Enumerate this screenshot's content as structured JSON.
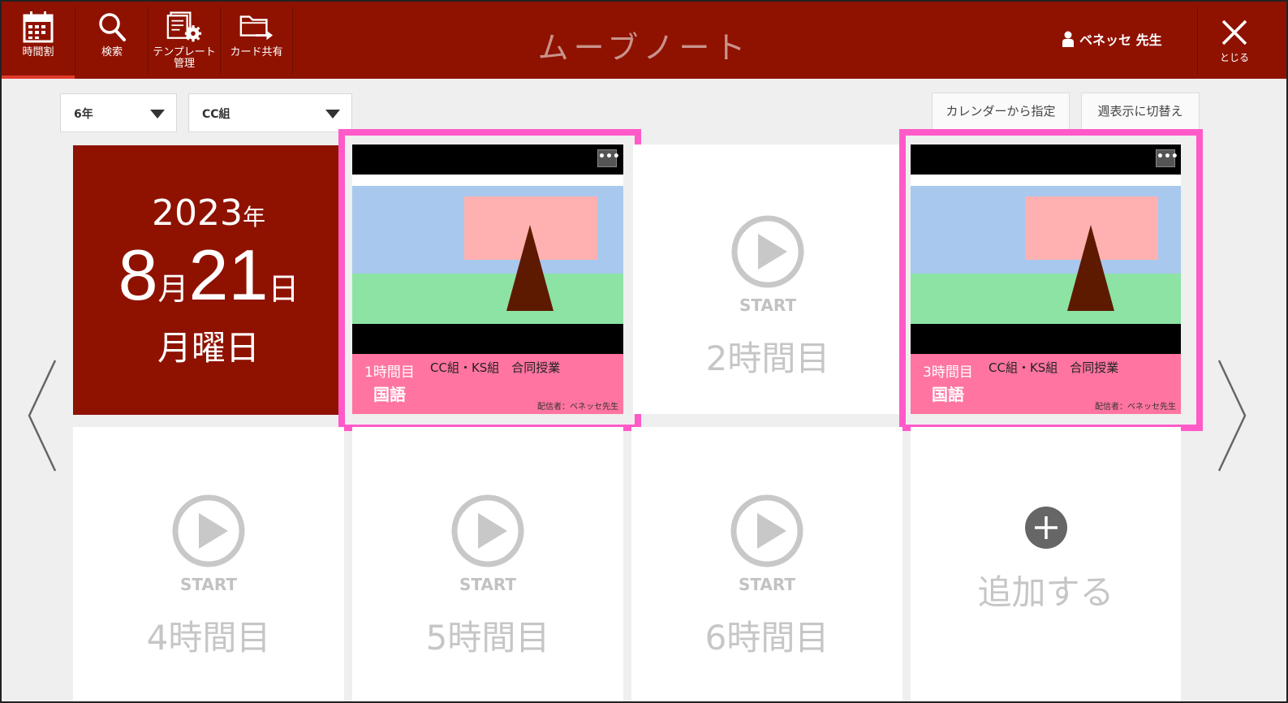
{
  "header": {
    "nav": [
      {
        "label": "時間割",
        "icon": "calendar-icon",
        "active": true
      },
      {
        "label": "検索",
        "icon": "search-icon"
      },
      {
        "label": "テンプレート\n管理",
        "label_line1": "テンプレート",
        "label_line2": "管理",
        "icon": "template-settings-icon"
      },
      {
        "label": "カード共有",
        "icon": "folder-share-icon"
      }
    ],
    "app_title": "ムーブノート",
    "user_name": "ベネッセ 先生",
    "close_label": "とじる"
  },
  "toolbar": {
    "grade": "6年",
    "class": "CC組",
    "calendar_button": "カレンダーから指定",
    "week_button": "週表示に切替え"
  },
  "date": {
    "year": "2023",
    "year_unit": "年",
    "month": "8",
    "month_unit": "月",
    "day": "21",
    "day_unit": "日",
    "weekday": "月曜日"
  },
  "lessons": [
    {
      "period": "1時間目",
      "classes": "CC組・KS組　合同授業",
      "subject": "国語",
      "distributor": "配信者：ベネッセ先生"
    },
    {
      "period": "3時間目",
      "classes": "CC組・KS組　合同授業",
      "subject": "国語",
      "distributor": "配信者：ベネッセ先生"
    }
  ],
  "empty_slots": [
    {
      "start": "START",
      "period": "2時間目"
    },
    {
      "start": "START",
      "period": "4時間目"
    },
    {
      "start": "START",
      "period": "5時間目"
    },
    {
      "start": "START",
      "period": "6時間目"
    }
  ],
  "add_slot": {
    "label": "追加する"
  },
  "colors": {
    "header_bg": "#8f1200",
    "lesson_info_bg": "#ff74a1",
    "highlight": "#ff5ac8"
  }
}
